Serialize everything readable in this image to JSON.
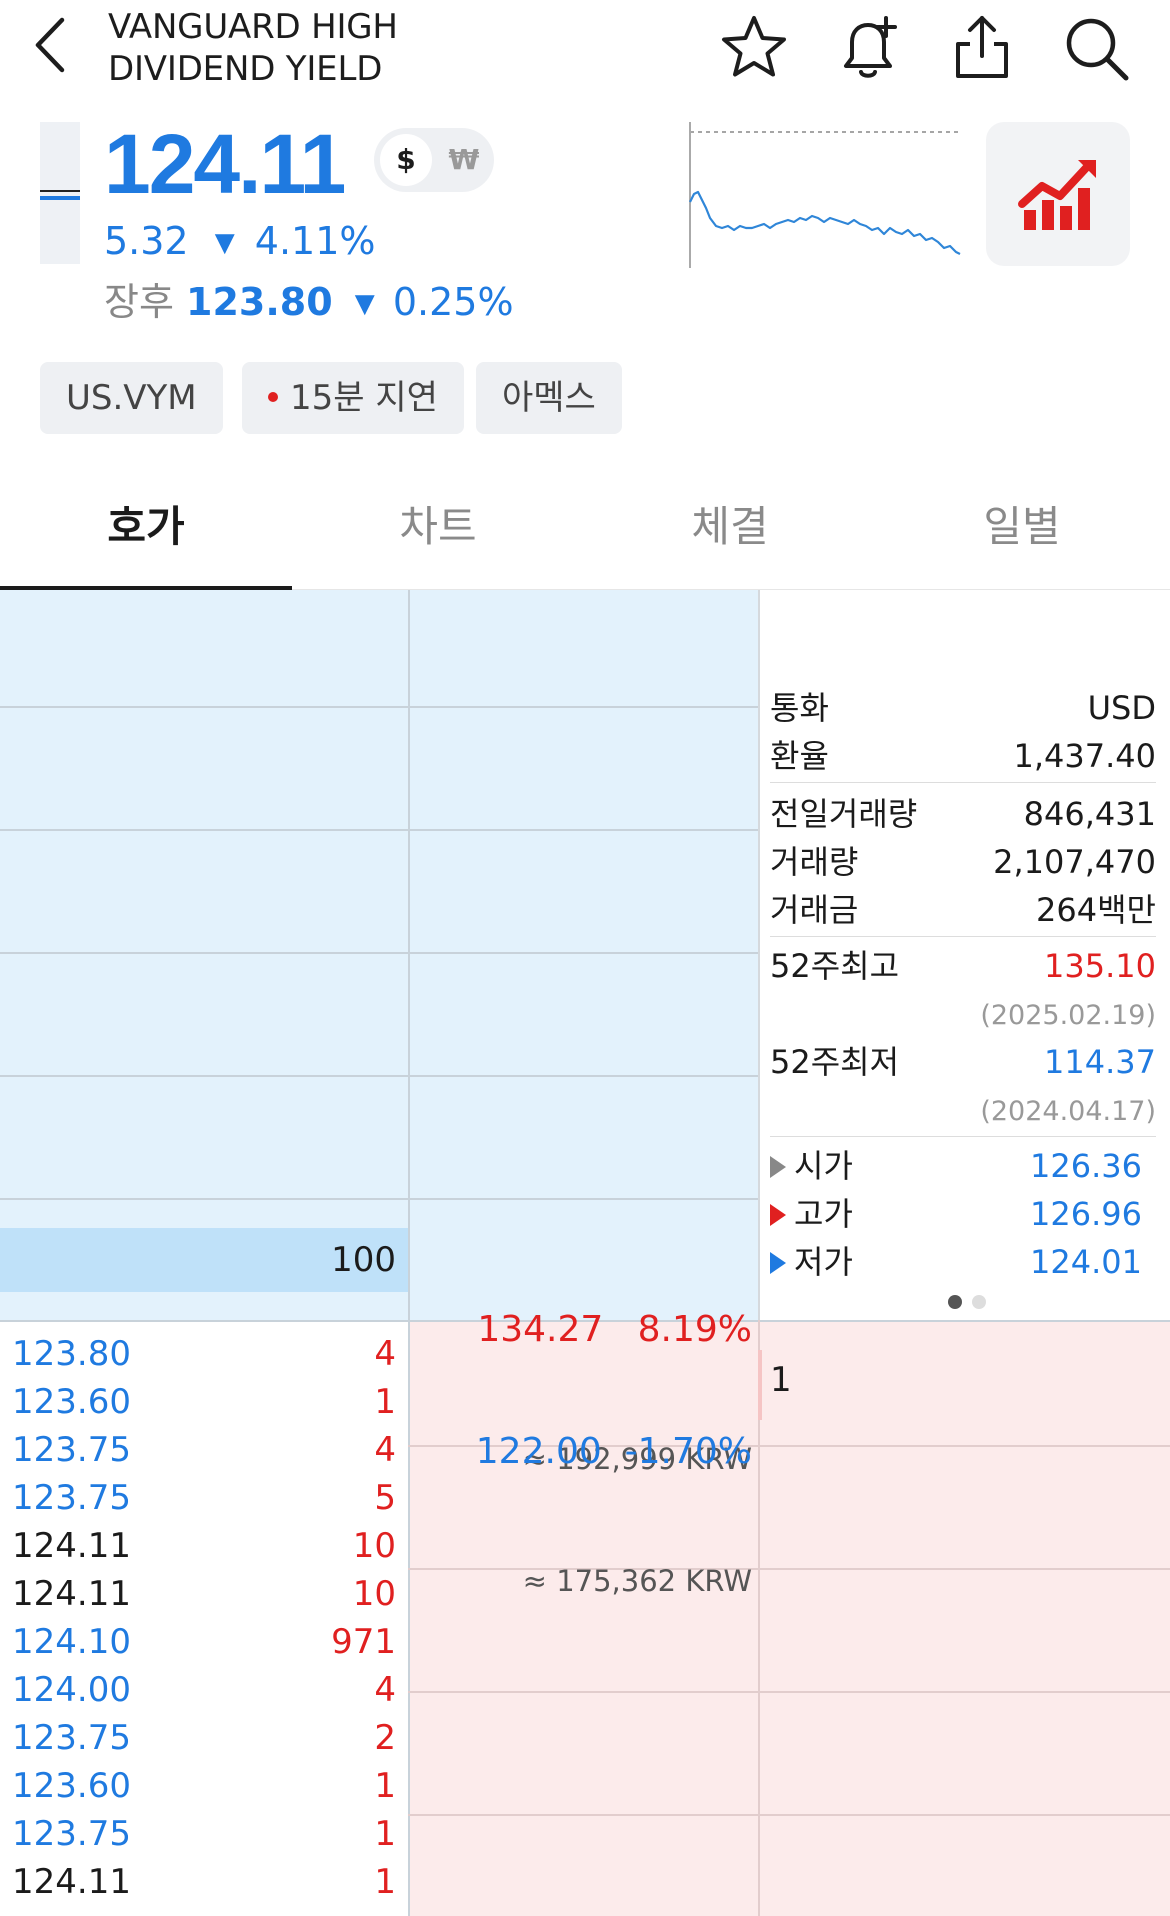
{
  "header": {
    "title_line1": "VANGUARD HIGH",
    "title_line2": "DIVIDEND YIELD",
    "icons": [
      "star-icon",
      "bell-plus-icon",
      "share-icon",
      "search-icon"
    ]
  },
  "quote": {
    "price": "124.11",
    "currency_usd": "$",
    "currency_krw": "₩",
    "change": "5.32",
    "change_pct": "4.11%",
    "after_label": "장후",
    "after_price": "123.80",
    "after_pct": "0.25%"
  },
  "chips": {
    "ticker": "US.VYM",
    "delay": "15분 지연",
    "exchange": "아멕스"
  },
  "tabs": [
    "호가",
    "차트",
    "체결",
    "일별"
  ],
  "orderbook": {
    "ask_volume": "100",
    "ask_price": "134.27   8.19%",
    "ask_krw": "≈ 192,999 KRW",
    "bid_price": "122.00  -1.70%",
    "bid_krw": "≈ 175,362 KRW",
    "bid_volume": "1"
  },
  "info": {
    "currency_label": "통화",
    "currency_value": "USD",
    "fx_label": "환율",
    "fx_value": "1,437.40",
    "prev_volume_label": "전일거래량",
    "prev_volume_value": "846,431",
    "volume_label": "거래량",
    "volume_value": "2,107,470",
    "amount_label": "거래금",
    "amount_value": "264백만",
    "high52_label": "52주최고",
    "high52_value": "135.10",
    "high52_date": "(2025.02.19)",
    "low52_label": "52주최저",
    "low52_value": "114.37",
    "low52_date": "(2024.04.17)",
    "open_label": "시가",
    "open_value": "126.36",
    "high_label": "고가",
    "high_value": "126.96",
    "low_label": "저가",
    "low_value": "124.01"
  },
  "trades": [
    {
      "price": "123.80",
      "qty": "4",
      "color": "#1f7ae0"
    },
    {
      "price": "123.60",
      "qty": "1",
      "color": "#1f7ae0"
    },
    {
      "price": "123.75",
      "qty": "4",
      "color": "#1f7ae0"
    },
    {
      "price": "123.75",
      "qty": "5",
      "color": "#1f7ae0"
    },
    {
      "price": "124.11",
      "qty": "10",
      "color": "#1b1b1b"
    },
    {
      "price": "124.11",
      "qty": "10",
      "color": "#1b1b1b"
    },
    {
      "price": "124.10",
      "qty": "971",
      "color": "#1f7ae0"
    },
    {
      "price": "124.00",
      "qty": "4",
      "color": "#1f7ae0"
    },
    {
      "price": "123.75",
      "qty": "2",
      "color": "#1f7ae0"
    },
    {
      "price": "123.60",
      "qty": "1",
      "color": "#1f7ae0"
    },
    {
      "price": "123.75",
      "qty": "1",
      "color": "#1f7ae0"
    },
    {
      "price": "124.11",
      "qty": "1",
      "color": "#1b1b1b"
    }
  ],
  "colors": {
    "up": "#e02020",
    "down": "#1f7ae0",
    "ask_bg": "#e3f2fc",
    "bid_bg": "#fcebeb"
  }
}
